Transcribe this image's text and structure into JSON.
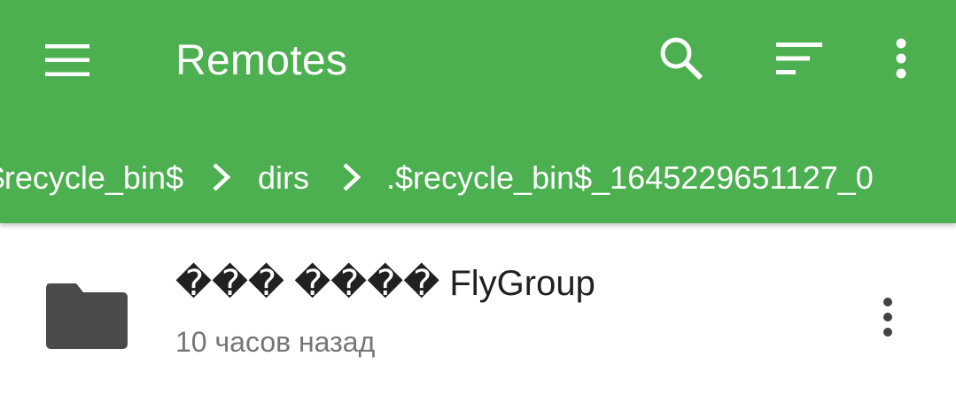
{
  "toolbar": {
    "title": "Remotes",
    "icons": {
      "menu": "menu-icon",
      "search": "search-icon",
      "sort": "sort-icon",
      "more": "more-vert-icon"
    }
  },
  "breadcrumb": {
    "items": [
      {
        "label": ".$recycle_bin$"
      },
      {
        "label": "dirs"
      },
      {
        "label": ".$recycle_bin$_1645229651127_0"
      }
    ],
    "separator_icon": "chevron-right-icon"
  },
  "files": [
    {
      "name": "��� ���� FlyGroup",
      "modified": "10 часов назад",
      "icon": "folder-icon",
      "more_icon": "more-vert-icon"
    }
  ],
  "colors": {
    "appbar": "#4caf50",
    "on_appbar": "#ffffff",
    "folder": "#4a4a4a",
    "primary_text": "#212121",
    "secondary_text": "#757575",
    "background": "#ffffff"
  }
}
